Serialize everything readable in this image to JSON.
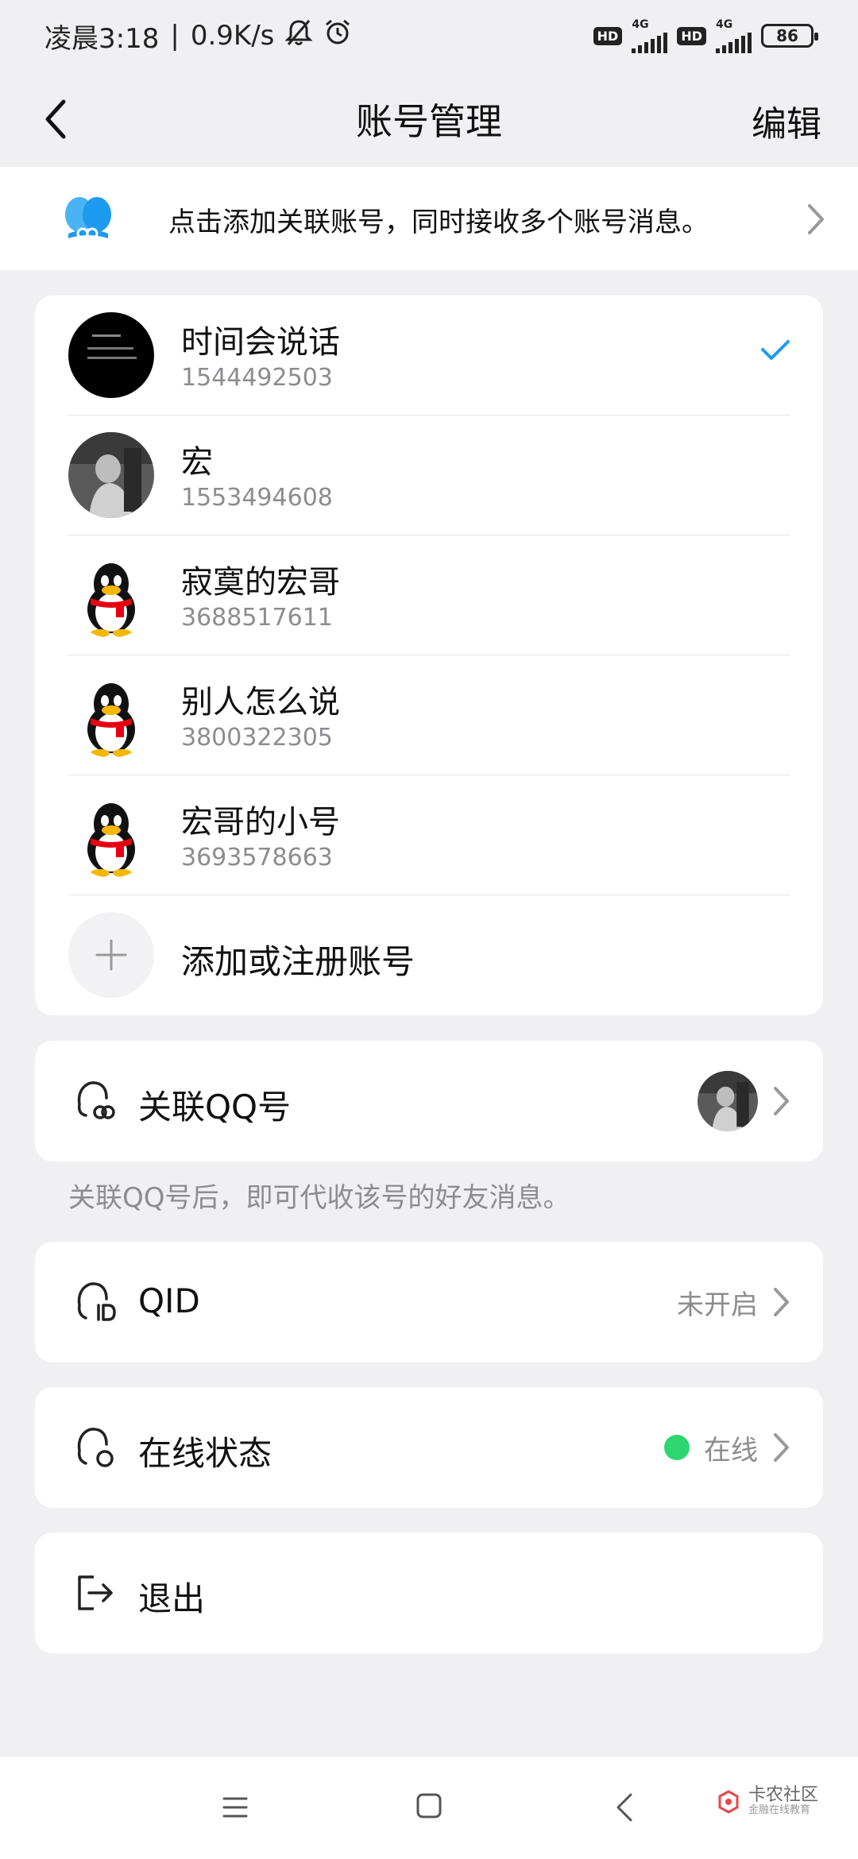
{
  "status_bar": {
    "time": "凌晨3:18",
    "speed": "0.9K/s",
    "hd_1": "HD",
    "net_1": "4G",
    "hd_2": "HD",
    "net_2": "4G",
    "battery": "86"
  },
  "nav": {
    "title": "账号管理",
    "edit_label": "编辑"
  },
  "banner": {
    "text": "点击添加关联账号，同时接收多个账号消息。"
  },
  "accounts": [
    {
      "name": "时间会说话",
      "qq": "1544492503",
      "selected": true,
      "avatar": "dark-text-avatar"
    },
    {
      "name": "宏",
      "qq": "1553494608",
      "selected": false,
      "avatar": "photo-avatar"
    },
    {
      "name": "寂寞的宏哥",
      "qq": "3688517611",
      "selected": false,
      "avatar": "penguin-avatar"
    },
    {
      "name": "别人怎么说",
      "qq": "3800322305",
      "selected": false,
      "avatar": "penguin-avatar"
    },
    {
      "name": "宏哥的小号",
      "qq": "3693578663",
      "selected": false,
      "avatar": "penguin-avatar"
    }
  ],
  "add_account": {
    "label": "添加或注册账号"
  },
  "linked_qq": {
    "label": "关联QQ号",
    "note": "关联QQ号后，即可代收该号的好友消息。"
  },
  "qid": {
    "label": "QID",
    "value": "未开启"
  },
  "online_status": {
    "label": "在线状态",
    "value": "在线",
    "dot_color": "#2fd670"
  },
  "logout": {
    "label": "退出"
  },
  "watermark": {
    "title": "卡农社区",
    "subtitle": "金融在线教育"
  },
  "colors": {
    "accent": "#1d9bf0",
    "background": "#f0f0f2",
    "card": "#ffffff",
    "secondary_text": "#8c8c91"
  }
}
